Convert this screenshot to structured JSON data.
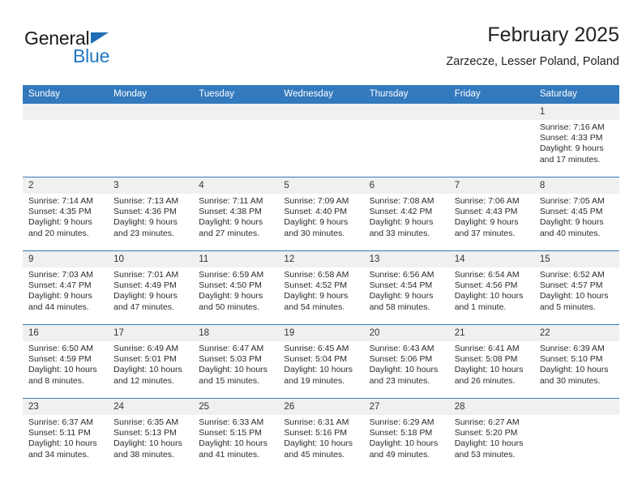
{
  "brand": {
    "word_one": "General",
    "word_two": "Blue",
    "accent_color": "#1f6db5"
  },
  "header": {
    "title": "February 2025",
    "subtitle": "Zarzecze, Lesser Poland, Poland"
  },
  "theme": {
    "header_bg": "#3379bd",
    "daynum_bg": "#f0f0f0",
    "grid_line": "#3379bd",
    "text": "#2b2b2b"
  },
  "weekdays": [
    "Sunday",
    "Monday",
    "Tuesday",
    "Wednesday",
    "Thursday",
    "Friday",
    "Saturday"
  ],
  "weeks": [
    [
      {
        "day": "",
        "sunrise": "",
        "sunset": "",
        "daylight_line1": "",
        "daylight_line2": ""
      },
      {
        "day": "",
        "sunrise": "",
        "sunset": "",
        "daylight_line1": "",
        "daylight_line2": ""
      },
      {
        "day": "",
        "sunrise": "",
        "sunset": "",
        "daylight_line1": "",
        "daylight_line2": ""
      },
      {
        "day": "",
        "sunrise": "",
        "sunset": "",
        "daylight_line1": "",
        "daylight_line2": ""
      },
      {
        "day": "",
        "sunrise": "",
        "sunset": "",
        "daylight_line1": "",
        "daylight_line2": ""
      },
      {
        "day": "",
        "sunrise": "",
        "sunset": "",
        "daylight_line1": "",
        "daylight_line2": ""
      },
      {
        "day": "1",
        "sunrise": "Sunrise: 7:16 AM",
        "sunset": "Sunset: 4:33 PM",
        "daylight_line1": "Daylight: 9 hours",
        "daylight_line2": "and 17 minutes."
      }
    ],
    [
      {
        "day": "2",
        "sunrise": "Sunrise: 7:14 AM",
        "sunset": "Sunset: 4:35 PM",
        "daylight_line1": "Daylight: 9 hours",
        "daylight_line2": "and 20 minutes."
      },
      {
        "day": "3",
        "sunrise": "Sunrise: 7:13 AM",
        "sunset": "Sunset: 4:36 PM",
        "daylight_line1": "Daylight: 9 hours",
        "daylight_line2": "and 23 minutes."
      },
      {
        "day": "4",
        "sunrise": "Sunrise: 7:11 AM",
        "sunset": "Sunset: 4:38 PM",
        "daylight_line1": "Daylight: 9 hours",
        "daylight_line2": "and 27 minutes."
      },
      {
        "day": "5",
        "sunrise": "Sunrise: 7:09 AM",
        "sunset": "Sunset: 4:40 PM",
        "daylight_line1": "Daylight: 9 hours",
        "daylight_line2": "and 30 minutes."
      },
      {
        "day": "6",
        "sunrise": "Sunrise: 7:08 AM",
        "sunset": "Sunset: 4:42 PM",
        "daylight_line1": "Daylight: 9 hours",
        "daylight_line2": "and 33 minutes."
      },
      {
        "day": "7",
        "sunrise": "Sunrise: 7:06 AM",
        "sunset": "Sunset: 4:43 PM",
        "daylight_line1": "Daylight: 9 hours",
        "daylight_line2": "and 37 minutes."
      },
      {
        "day": "8",
        "sunrise": "Sunrise: 7:05 AM",
        "sunset": "Sunset: 4:45 PM",
        "daylight_line1": "Daylight: 9 hours",
        "daylight_line2": "and 40 minutes."
      }
    ],
    [
      {
        "day": "9",
        "sunrise": "Sunrise: 7:03 AM",
        "sunset": "Sunset: 4:47 PM",
        "daylight_line1": "Daylight: 9 hours",
        "daylight_line2": "and 44 minutes."
      },
      {
        "day": "10",
        "sunrise": "Sunrise: 7:01 AM",
        "sunset": "Sunset: 4:49 PM",
        "daylight_line1": "Daylight: 9 hours",
        "daylight_line2": "and 47 minutes."
      },
      {
        "day": "11",
        "sunrise": "Sunrise: 6:59 AM",
        "sunset": "Sunset: 4:50 PM",
        "daylight_line1": "Daylight: 9 hours",
        "daylight_line2": "and 50 minutes."
      },
      {
        "day": "12",
        "sunrise": "Sunrise: 6:58 AM",
        "sunset": "Sunset: 4:52 PM",
        "daylight_line1": "Daylight: 9 hours",
        "daylight_line2": "and 54 minutes."
      },
      {
        "day": "13",
        "sunrise": "Sunrise: 6:56 AM",
        "sunset": "Sunset: 4:54 PM",
        "daylight_line1": "Daylight: 9 hours",
        "daylight_line2": "and 58 minutes."
      },
      {
        "day": "14",
        "sunrise": "Sunrise: 6:54 AM",
        "sunset": "Sunset: 4:56 PM",
        "daylight_line1": "Daylight: 10 hours",
        "daylight_line2": "and 1 minute."
      },
      {
        "day": "15",
        "sunrise": "Sunrise: 6:52 AM",
        "sunset": "Sunset: 4:57 PM",
        "daylight_line1": "Daylight: 10 hours",
        "daylight_line2": "and 5 minutes."
      }
    ],
    [
      {
        "day": "16",
        "sunrise": "Sunrise: 6:50 AM",
        "sunset": "Sunset: 4:59 PM",
        "daylight_line1": "Daylight: 10 hours",
        "daylight_line2": "and 8 minutes."
      },
      {
        "day": "17",
        "sunrise": "Sunrise: 6:49 AM",
        "sunset": "Sunset: 5:01 PM",
        "daylight_line1": "Daylight: 10 hours",
        "daylight_line2": "and 12 minutes."
      },
      {
        "day": "18",
        "sunrise": "Sunrise: 6:47 AM",
        "sunset": "Sunset: 5:03 PM",
        "daylight_line1": "Daylight: 10 hours",
        "daylight_line2": "and 15 minutes."
      },
      {
        "day": "19",
        "sunrise": "Sunrise: 6:45 AM",
        "sunset": "Sunset: 5:04 PM",
        "daylight_line1": "Daylight: 10 hours",
        "daylight_line2": "and 19 minutes."
      },
      {
        "day": "20",
        "sunrise": "Sunrise: 6:43 AM",
        "sunset": "Sunset: 5:06 PM",
        "daylight_line1": "Daylight: 10 hours",
        "daylight_line2": "and 23 minutes."
      },
      {
        "day": "21",
        "sunrise": "Sunrise: 6:41 AM",
        "sunset": "Sunset: 5:08 PM",
        "daylight_line1": "Daylight: 10 hours",
        "daylight_line2": "and 26 minutes."
      },
      {
        "day": "22",
        "sunrise": "Sunrise: 6:39 AM",
        "sunset": "Sunset: 5:10 PM",
        "daylight_line1": "Daylight: 10 hours",
        "daylight_line2": "and 30 minutes."
      }
    ],
    [
      {
        "day": "23",
        "sunrise": "Sunrise: 6:37 AM",
        "sunset": "Sunset: 5:11 PM",
        "daylight_line1": "Daylight: 10 hours",
        "daylight_line2": "and 34 minutes."
      },
      {
        "day": "24",
        "sunrise": "Sunrise: 6:35 AM",
        "sunset": "Sunset: 5:13 PM",
        "daylight_line1": "Daylight: 10 hours",
        "daylight_line2": "and 38 minutes."
      },
      {
        "day": "25",
        "sunrise": "Sunrise: 6:33 AM",
        "sunset": "Sunset: 5:15 PM",
        "daylight_line1": "Daylight: 10 hours",
        "daylight_line2": "and 41 minutes."
      },
      {
        "day": "26",
        "sunrise": "Sunrise: 6:31 AM",
        "sunset": "Sunset: 5:16 PM",
        "daylight_line1": "Daylight: 10 hours",
        "daylight_line2": "and 45 minutes."
      },
      {
        "day": "27",
        "sunrise": "Sunrise: 6:29 AM",
        "sunset": "Sunset: 5:18 PM",
        "daylight_line1": "Daylight: 10 hours",
        "daylight_line2": "and 49 minutes."
      },
      {
        "day": "28",
        "sunrise": "Sunrise: 6:27 AM",
        "sunset": "Sunset: 5:20 PM",
        "daylight_line1": "Daylight: 10 hours",
        "daylight_line2": "and 53 minutes."
      },
      {
        "day": "",
        "sunrise": "",
        "sunset": "",
        "daylight_line1": "",
        "daylight_line2": ""
      }
    ]
  ]
}
